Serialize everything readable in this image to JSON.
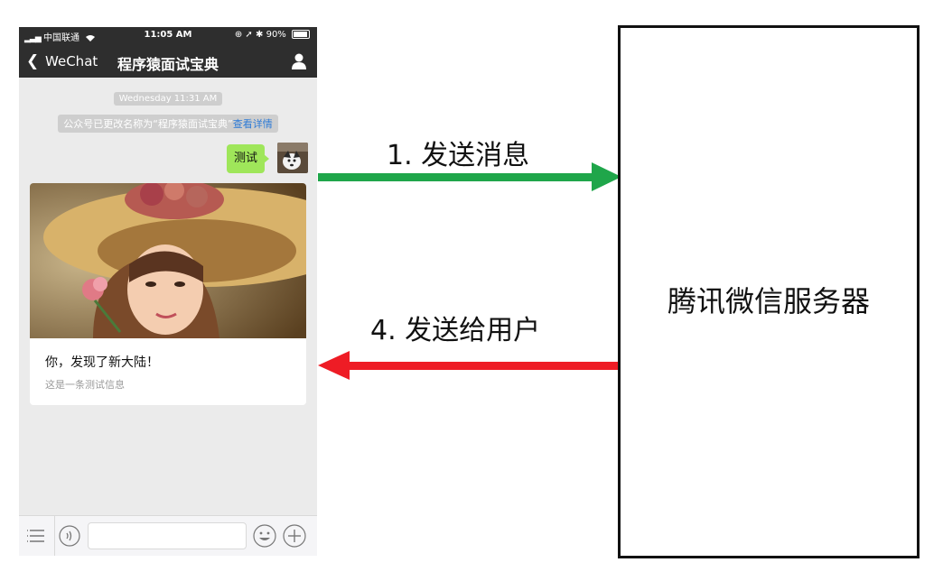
{
  "phone": {
    "status": {
      "carrier": "中国联通",
      "time": "11:05 AM",
      "battery": "90%"
    },
    "nav": {
      "back_label": "WeChat",
      "title": "程序猿面试宝典"
    },
    "chat": {
      "timestamp": "Wednesday 11:31 AM",
      "system_note": "公众号已更改名称为“程序猿面试宝典”",
      "system_note_link": "查看详情",
      "sent_message": "测试",
      "card_title": "你，发现了新大陆！",
      "card_description": "这是一条测试信息"
    },
    "input_bar": {
      "icons": [
        "menu-icon",
        "voice-icon",
        "emoji-icon",
        "plus-icon"
      ]
    }
  },
  "arrows": [
    {
      "label": "1. 发送消息",
      "color": "#1fa64a",
      "direction": "right"
    },
    {
      "label": "4. 发送给用户",
      "color": "#ee1c25",
      "direction": "left"
    }
  ],
  "server": {
    "label": "腾讯微信服务器"
  }
}
